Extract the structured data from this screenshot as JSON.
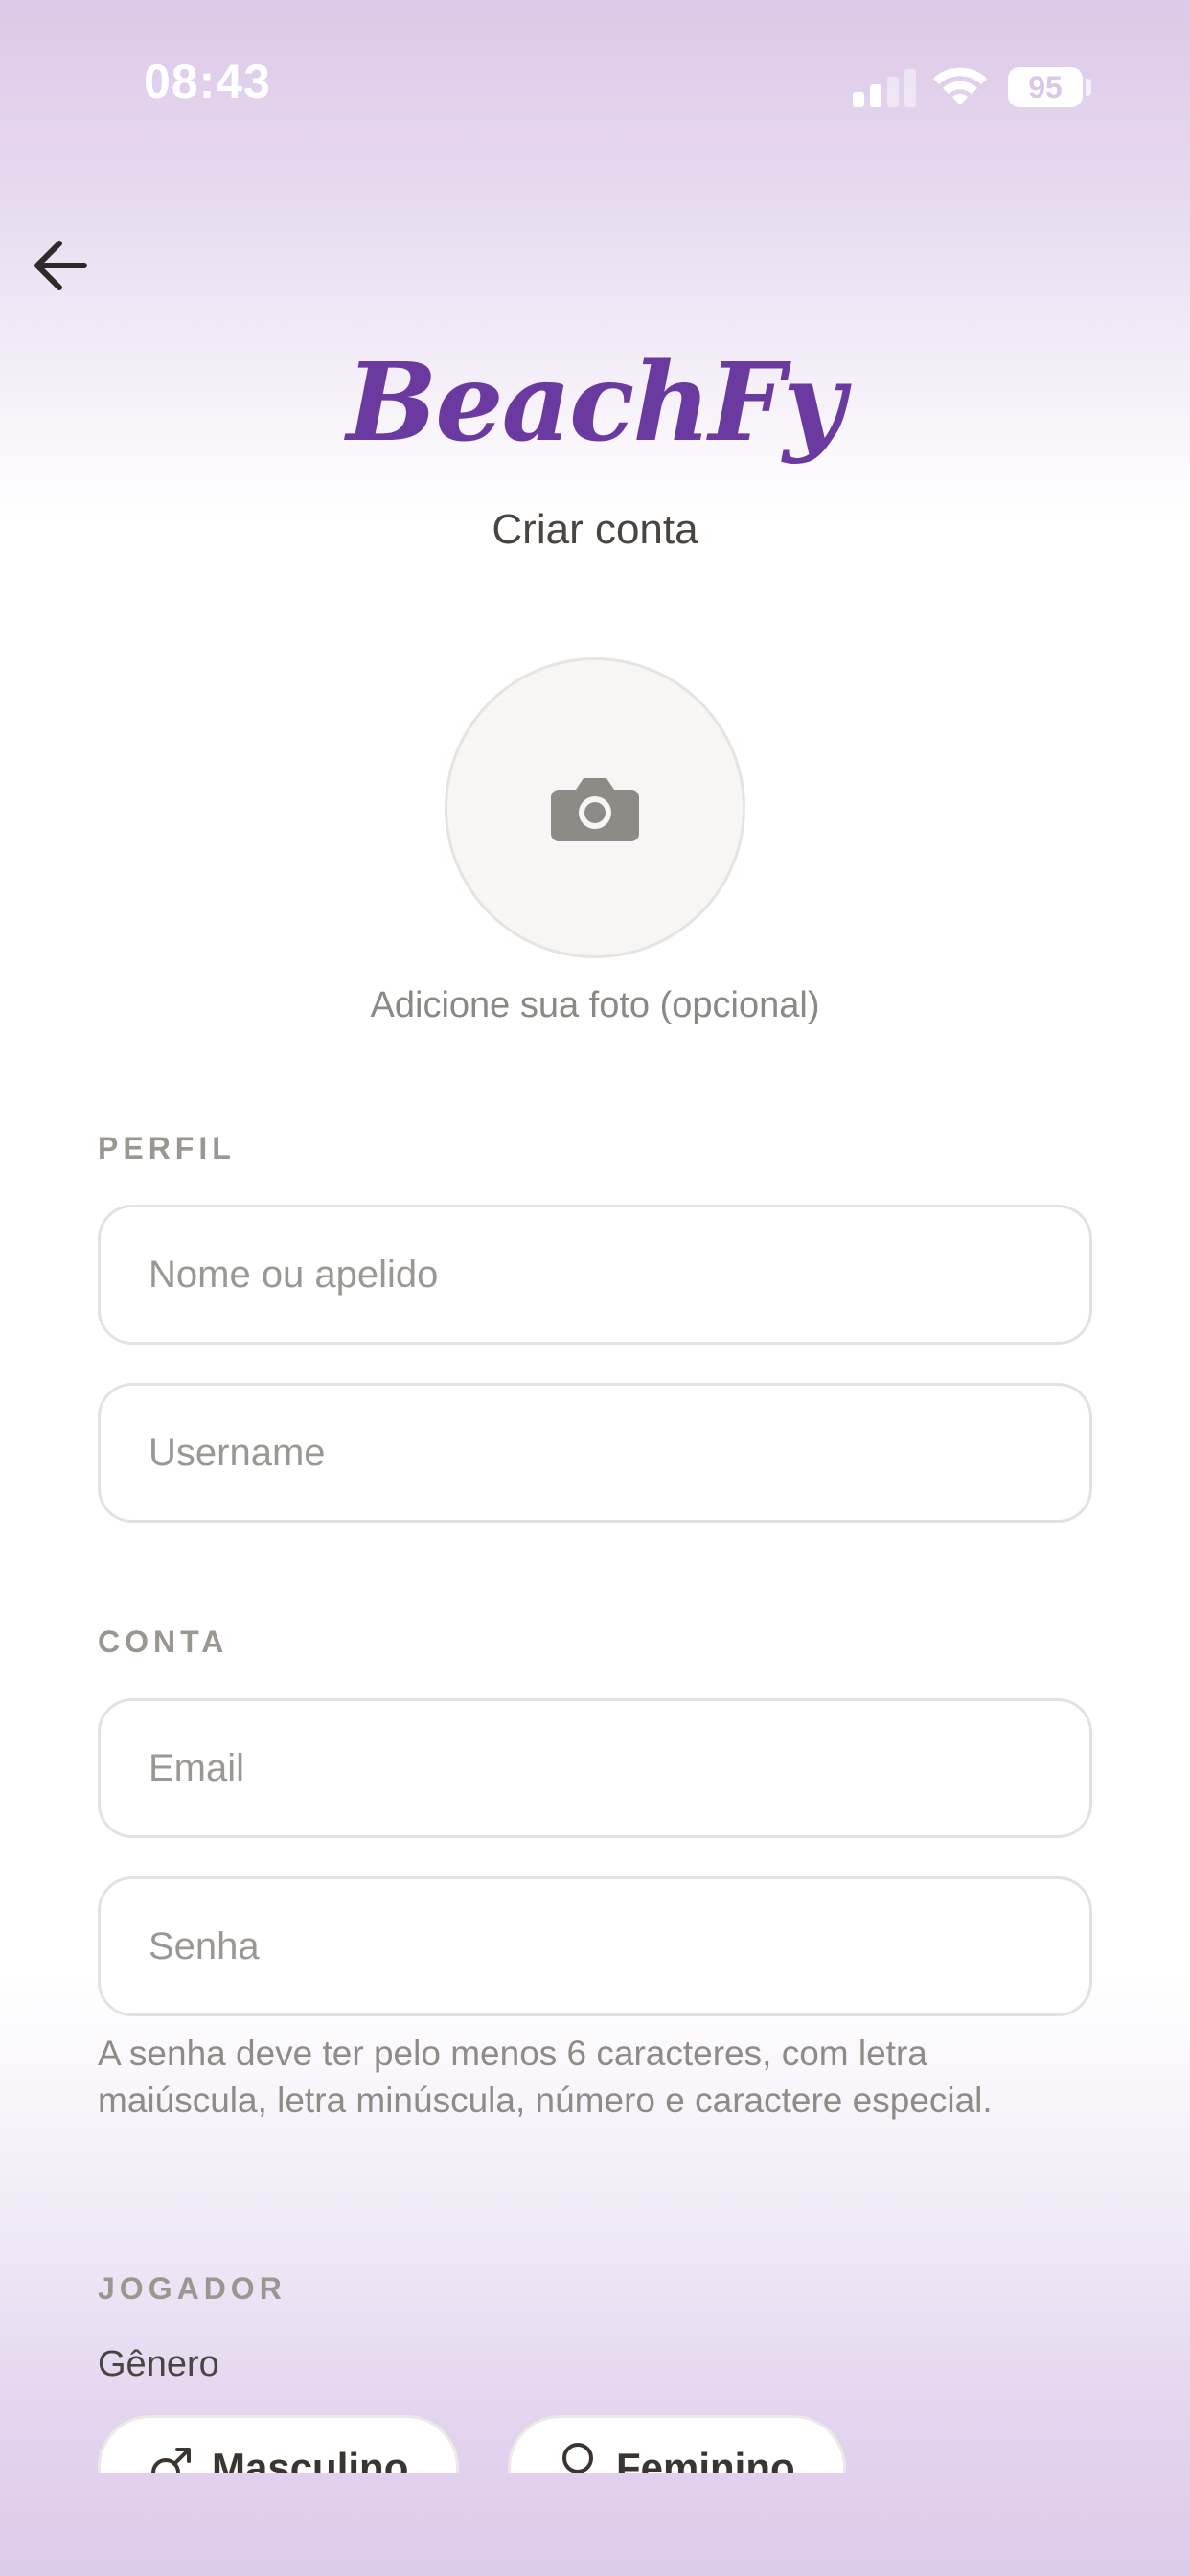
{
  "status_bar": {
    "time": "08:43",
    "battery": "95",
    "icons": [
      "signal-icon",
      "wifi-icon",
      "battery-icon"
    ]
  },
  "header": {
    "back_icon": "arrow-left-icon",
    "brand": "BeachFy",
    "title": "Criar conta"
  },
  "photo": {
    "icon": "camera-icon",
    "hint": "Adicione sua foto (opcional)"
  },
  "sections": {
    "profile": {
      "label": "PERFIL",
      "name_placeholder": "Nome ou apelido",
      "username_placeholder": "Username"
    },
    "account": {
      "label": "CONTA",
      "email_placeholder": "Email",
      "password_placeholder": "Senha",
      "password_helper": "A senha deve ter pelo menos 6 caracteres, com letra maiúscula, letra minúscula, número e caractere especial."
    },
    "player": {
      "label": "JOGADOR",
      "gender_label": "Gênero",
      "gender_options": [
        {
          "label": "Masculino",
          "icon": "male-symbol-icon"
        },
        {
          "label": "Feminino",
          "icon": "female-symbol-icon"
        }
      ]
    }
  },
  "colors": {
    "brand": "#6b3aa0",
    "gradient_top": "#dcc8e8",
    "gradient_bottom": "#dccbeb",
    "field_border": "#e4e2df",
    "muted_text": "#9a9690"
  }
}
